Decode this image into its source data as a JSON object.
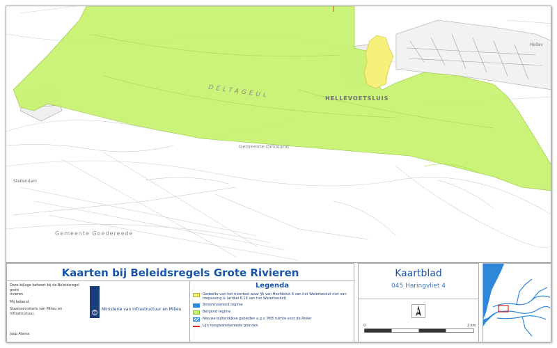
{
  "colors": {
    "green": "#c8f26e",
    "yellow": "#f5f07a",
    "blue": "#2e87d8",
    "red": "#e02020",
    "accent": "#1a56a8"
  },
  "map": {
    "labels": {
      "hellevoetsluis": "HELLEVOETSLUIS",
      "deltageul": "DELTAGEUL",
      "gemeente_dirksland": "Gemeente Dirksland",
      "gemeente_goedereede": "Gemeente Goedereede",
      "stellendam": "Stellendam",
      "hellevoetsluis_corner": "Hellev"
    }
  },
  "footer": {
    "title": "Kaarten bij Beleidsregels Grote Rivieren",
    "note": {
      "line1": "Deze bijlage behoort bij de Beleidsregel grote",
      "line2": "rivieren",
      "line3": "Mij bekend,",
      "line4": "Staatssecretaris van Milieu en Infrastructuur,",
      "signature": "Joop Atsma"
    },
    "ministry": "Ministerie van Infrastructuur en Milieu",
    "legend": {
      "title": "Legenda",
      "items": [
        {
          "text": "Gedeelte van het rivierbed waar §6 van Hoofdstuk 6 van het Waterbesluit niet van toepassing is (artikel 6.16 van het Waterbesluit)",
          "swatch": "yellow"
        },
        {
          "text": "Stroomvoerend regime",
          "swatch": "blue"
        },
        {
          "text": "Bergend regime",
          "swatch": "green"
        },
        {
          "text": "Nieuwe buitendijkse gebieden a.g.v. PKB ruimte voor de Rivier",
          "swatch": "hatch"
        },
        {
          "text": "Lijn hoogwaterkerende gronden",
          "swatch": "line"
        }
      ]
    },
    "kaartblad": {
      "title": "Kaartblad",
      "subtitle": "045 Haringvliet 4",
      "north_label": "N",
      "scale_start": "0",
      "scale_end": "2 km"
    }
  }
}
